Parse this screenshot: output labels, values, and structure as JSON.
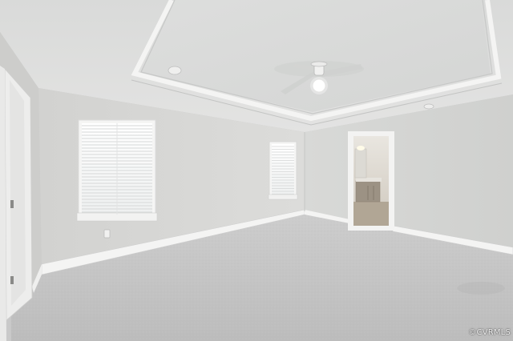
{
  "photo": {
    "subject": "empty-bedroom-interior",
    "watermark": "©CVRMLS",
    "colors": {
      "wall_left": "#d6d6d4",
      "wall_right": "#d2d3d1",
      "ceiling": "#dedfde",
      "carpet": "#c4c4c4",
      "trim": "#f2f2f0",
      "window_glass": "#f7f8f8"
    },
    "icons": [
      "ceiling-fan-icon",
      "window-blinds-icon",
      "doorway-icon",
      "outlet-icon"
    ]
  }
}
